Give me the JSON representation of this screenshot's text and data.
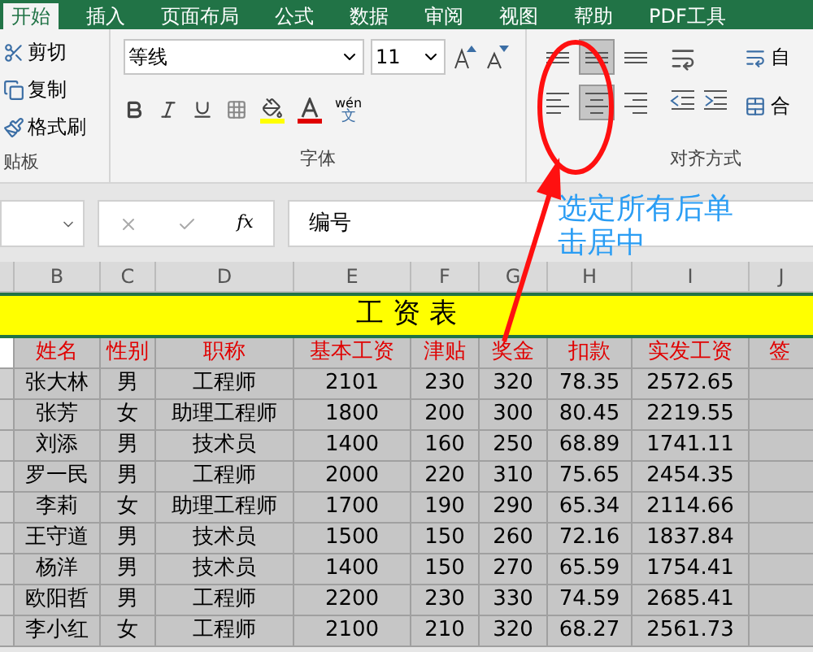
{
  "ribbon_tabs": [
    {
      "label": "开始",
      "selected": true
    },
    {
      "label": "插入",
      "selected": false
    },
    {
      "label": "页面布局",
      "selected": false
    },
    {
      "label": "公式",
      "selected": false
    },
    {
      "label": "数据",
      "selected": false
    },
    {
      "label": "审阅",
      "selected": false
    },
    {
      "label": "视图",
      "selected": false
    },
    {
      "label": "帮助",
      "selected": false
    },
    {
      "label": "PDF工具",
      "selected": false
    }
  ],
  "clipboard": {
    "items": [
      {
        "kind": "cut",
        "label": "剪切"
      },
      {
        "kind": "copy",
        "label": "复制"
      },
      {
        "kind": "painter",
        "label": "格式刷"
      }
    ],
    "label": "贴板"
  },
  "font": {
    "name": "等线",
    "size": "11",
    "label": "字体",
    "wen": "wén",
    "wen_char": "文"
  },
  "alignment": {
    "label": "对齐方式",
    "wrap": "自",
    "merge": "合",
    "buttons": [
      {
        "kind": "top",
        "selected": false
      },
      {
        "kind": "middle",
        "selected": true
      },
      {
        "kind": "bottom",
        "selected": false
      },
      {
        "kind": "left",
        "selected": false
      },
      {
        "kind": "center",
        "selected": true
      },
      {
        "kind": "right",
        "selected": false
      }
    ]
  },
  "formula_bar": {
    "fx": "fx",
    "value": "编号"
  },
  "columns": [
    "B",
    "C",
    "D",
    "E",
    "F",
    "G",
    "H",
    "I",
    "J"
  ],
  "sheet": {
    "title": "工 资 表",
    "headers": [
      "姓名",
      "性别",
      "职称",
      "基本工资",
      "津贴",
      "奖金",
      "扣款",
      "实发工资",
      "签"
    ],
    "rows": [
      [
        "张大林",
        "男",
        "工程师",
        "2101",
        "230",
        "320",
        "78.35",
        "2572.65"
      ],
      [
        "张芳",
        "女",
        "助理工程师",
        "1800",
        "200",
        "300",
        "80.45",
        "2219.55"
      ],
      [
        "刘添",
        "男",
        "技术员",
        "1400",
        "160",
        "250",
        "68.89",
        "1741.11"
      ],
      [
        "罗一民",
        "男",
        "工程师",
        "2000",
        "220",
        "310",
        "75.65",
        "2454.35"
      ],
      [
        "李莉",
        "女",
        "助理工程师",
        "1700",
        "190",
        "290",
        "65.34",
        "2114.66"
      ],
      [
        "王守道",
        "男",
        "技术员",
        "1500",
        "150",
        "260",
        "72.16",
        "1837.84"
      ],
      [
        "杨洋",
        "男",
        "技术员",
        "1400",
        "150",
        "270",
        "65.59",
        "1754.41"
      ],
      [
        "欧阳哲",
        "男",
        "工程师",
        "2200",
        "230",
        "330",
        "74.59",
        "2685.41"
      ],
      [
        "李小红",
        "女",
        "工程师",
        "2100",
        "210",
        "320",
        "68.27",
        "2561.73"
      ]
    ]
  },
  "annotation": {
    "text": "选定所有后单击居中"
  }
}
